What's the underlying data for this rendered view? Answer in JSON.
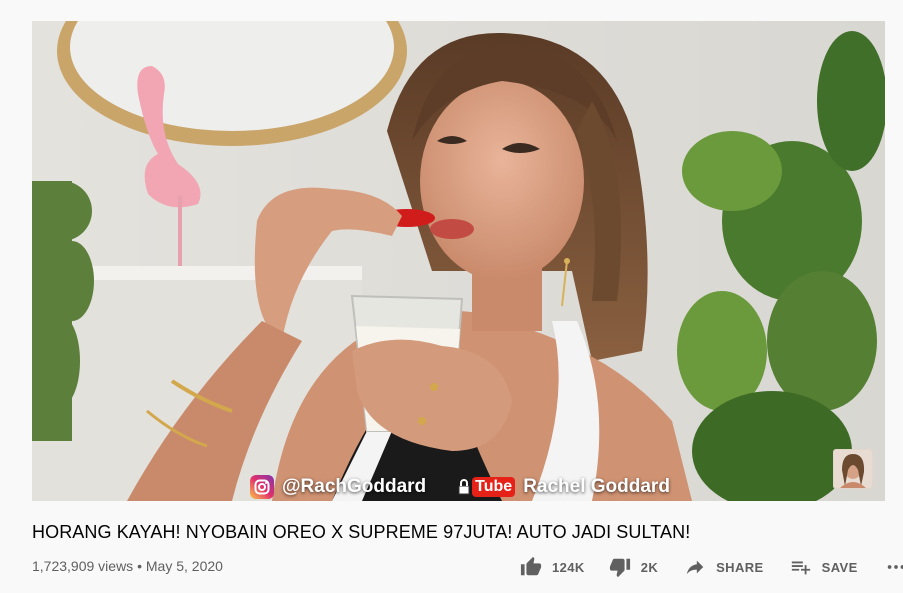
{
  "video": {
    "title": "HORANG KAYAH! NYOBAIN OREO X SUPREME 97JUTA! AUTO JADI SULTAN!",
    "views": "1,723,909 views",
    "separator": "•",
    "date": "May 5, 2020",
    "overlay": {
      "instagram_handle": "@RachGoddard",
      "youtube_channel": "Rachel Goddard",
      "youtube_logo_text": "Tube"
    }
  },
  "actions": {
    "like_count": "124K",
    "dislike_count": "2K",
    "share_label": "SHARE",
    "save_label": "SAVE"
  },
  "icons": {
    "like": "thumbs-up-icon",
    "dislike": "thumbs-down-icon",
    "share": "share-arrow-icon",
    "save": "playlist-add-icon",
    "more": "more-horizontal-icon"
  },
  "colors": {
    "page_background": "#f9f9f9",
    "title_text": "#030303",
    "secondary_text": "#606060",
    "youtube_red": "#e62117"
  }
}
